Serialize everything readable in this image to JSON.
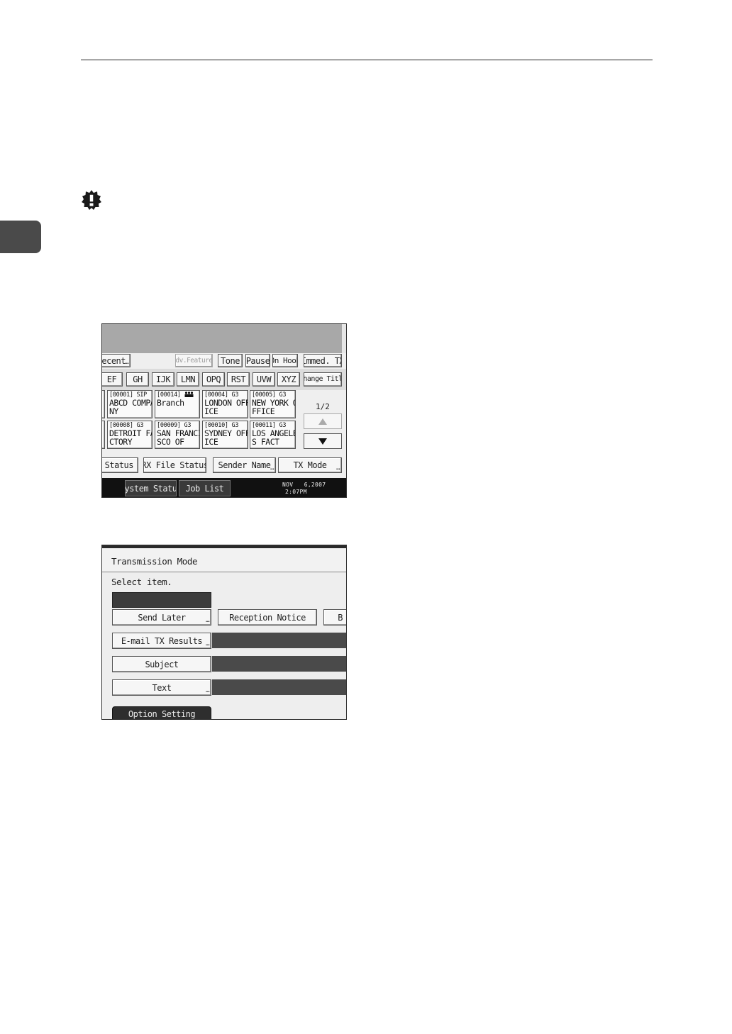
{
  "screen1": {
    "toolbar": {
      "recent": "Recent",
      "adv_features": "Adv.Features",
      "tone": "Tone",
      "pause": "Pause",
      "on_hook": "On Hook",
      "immed_tx": "Immed. TX"
    },
    "tabs": [
      "EF",
      "GH",
      "IJK",
      "LMN",
      "OPQ",
      "RST",
      "UVW",
      "XYZ"
    ],
    "change_title": "Change Title",
    "destinations": [
      {
        "id": "[00001] SIP",
        "line1": "ABCD COMPA",
        "line2": "NY"
      },
      {
        "id": "[00014]",
        "line1": "Branch",
        "line2": ""
      },
      {
        "id": "[00004] G3",
        "line1": "LONDON OFF",
        "line2": "ICE"
      },
      {
        "id": "[00005] G3",
        "line1": "NEW YORK O",
        "line2": "FFICE"
      },
      {
        "id": "[00008] G3",
        "line1": "DETROIT FA",
        "line2": "CTORY"
      },
      {
        "id": "[00009] G3",
        "line1": "SAN FRANCI",
        "line2": "SCO OF"
      },
      {
        "id": "[00010] G3",
        "line1": "SYDNEY OFF",
        "line2": "ICE"
      },
      {
        "id": "[00011] G3",
        "line1": "LOS ANGELE",
        "line2": "S FACT"
      }
    ],
    "page_indicator": "1/2",
    "function_keys": {
      "file_status": "le Status",
      "rx_file_status": "RX File Status",
      "sender_name": "Sender Name",
      "tx_mode": "TX Mode"
    },
    "status_bar": {
      "system_status": "System Status",
      "job_list": "Job List",
      "date": "NOV   6,2007",
      "time": "2:07PM"
    }
  },
  "screen2": {
    "title": "Transmission Mode",
    "instruction": "Select item.",
    "send_later": "Send Later",
    "reception_notice": "Reception Notice",
    "cut_button": "B",
    "email_tx_results": "E-mail TX Results",
    "subject": "Subject",
    "text": "Text",
    "option_setting": "Option Setting"
  },
  "icons": {
    "important": "important-icon",
    "group": "group-icon",
    "up": "up-arrow-icon",
    "down": "down-arrow-icon"
  }
}
